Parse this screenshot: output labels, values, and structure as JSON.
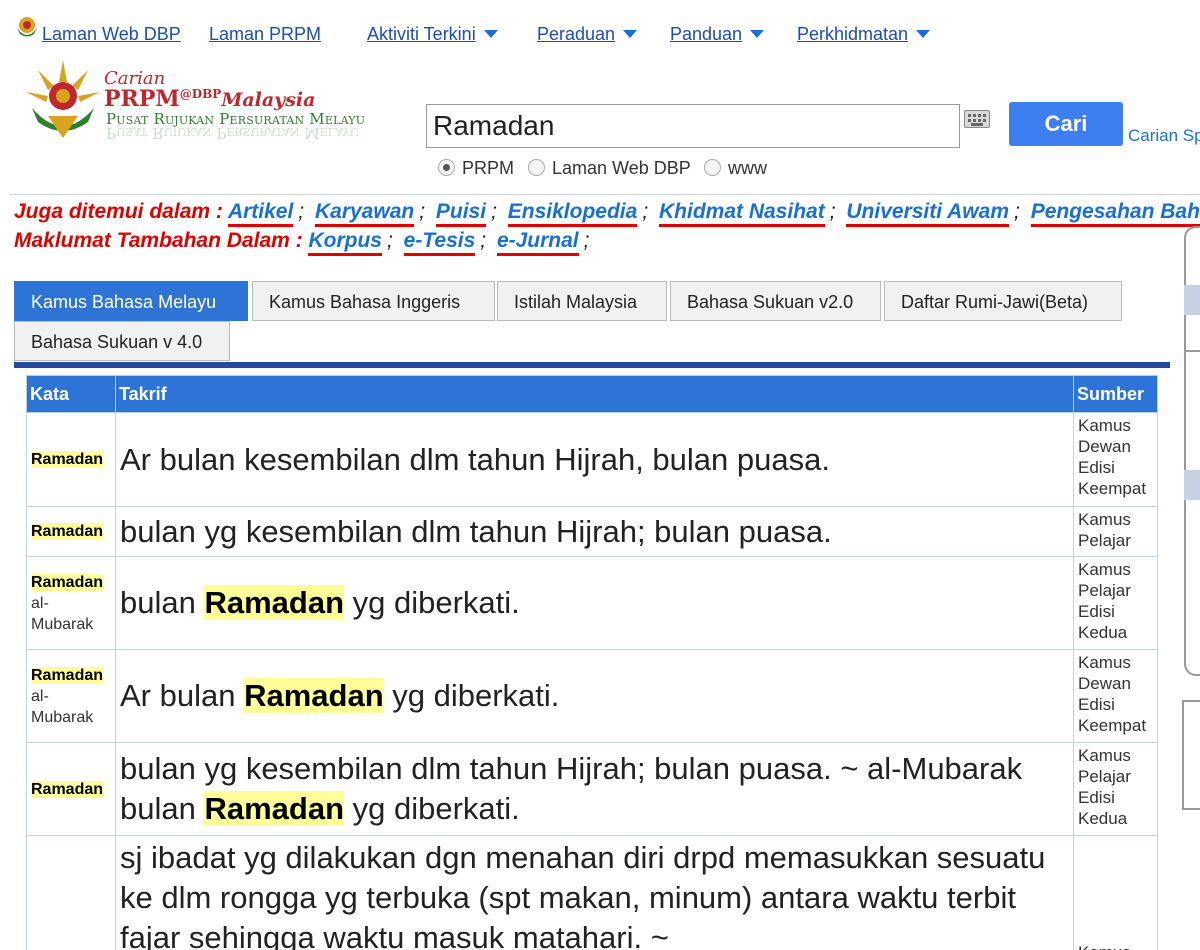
{
  "nav": {
    "items": [
      {
        "label": "Laman Web DBP",
        "dropdown": false
      },
      {
        "label": "Laman PRPM",
        "dropdown": false
      },
      {
        "label": "Aktiviti Terkini",
        "dropdown": true
      },
      {
        "label": "Peraduan",
        "dropdown": true
      },
      {
        "label": "Panduan",
        "dropdown": true
      },
      {
        "label": "Perkhidmatan",
        "dropdown": true
      }
    ]
  },
  "logo": {
    "carian": "Carian",
    "prpm": "PRPM",
    "dbp": "@DBP",
    "malaysia": "Malaysia",
    "pusat": "Pusat Rujukan Persuratan Melayu"
  },
  "search": {
    "value": "Ramadan",
    "button_label": "Cari",
    "carian_sp": "Carian Sp",
    "options": [
      {
        "label": "PRPM",
        "selected": true
      },
      {
        "label": "Laman Web DBP",
        "selected": false
      },
      {
        "label": "www",
        "selected": false
      }
    ]
  },
  "also_found": {
    "label": "Juga ditemui dalam :",
    "links": [
      "Artikel",
      "Karyawan",
      "Puisi",
      "Ensiklopedia",
      "Khidmat Nasihat",
      "Universiti Awam",
      "Pengesahan Bahasa"
    ]
  },
  "more_info": {
    "label": "Maklumat Tambahan Dalam :",
    "links": [
      "Korpus",
      "e-Tesis",
      "e-Jurnal"
    ]
  },
  "tabs": [
    {
      "label": "Kamus Bahasa Melayu",
      "active": true
    },
    {
      "label": "Kamus Bahasa Inggeris",
      "active": false
    },
    {
      "label": "Istilah Malaysia",
      "active": false
    },
    {
      "label": "Bahasa Sukuan v2.0",
      "active": false
    },
    {
      "label": "Daftar Rumi-Jawi(Beta)",
      "active": false
    },
    {
      "label": "Bahasa Sukuan v 4.0",
      "active": false
    }
  ],
  "table": {
    "headers": {
      "kata": "Kata",
      "takrif": "Takrif",
      "sumber": "Sumber"
    },
    "rows": [
      {
        "kata_hl": "Ramadan",
        "kata_rest": "",
        "takrif": [
          [
            "t",
            "Ar bulan kesembilan dlm tahun Hijrah, bulan puasa."
          ]
        ],
        "sumber": "Kamus Dewan Edisi Keempat"
      },
      {
        "kata_hl": "Ramadan",
        "kata_rest": "",
        "takrif": [
          [
            "t",
            "bulan yg kesembilan dlm tahun Hijrah; bulan puasa."
          ]
        ],
        "sumber": "Kamus Pelajar"
      },
      {
        "kata_hl": "Ramadan",
        "kata_rest": "al-Mubarak",
        "takrif": [
          [
            "t",
            "bulan "
          ],
          [
            "h",
            "Ramadan"
          ],
          [
            "t",
            " yg diberkati."
          ]
        ],
        "sumber": "Kamus Pelajar Edisi Kedua"
      },
      {
        "kata_hl": "Ramadan",
        "kata_rest": "al-Mubarak",
        "takrif": [
          [
            "t",
            "Ar bulan "
          ],
          [
            "h",
            "Ramadan"
          ],
          [
            "t",
            " yg diberkati."
          ]
        ],
        "sumber": "Kamus Dewan Edisi Keempat"
      },
      {
        "kata_hl": "Ramadan",
        "kata_rest": "",
        "takrif": [
          [
            "t",
            "bulan yg kesembilan dlm tahun Hijrah; bulan puasa. ~ al-Mubarak bulan "
          ],
          [
            "h",
            "Ramadan"
          ],
          [
            "t",
            " yg diberkati."
          ]
        ],
        "sumber": "Kamus Pelajar Edisi Kedua"
      },
      {
        "kata_hl": "",
        "kata_rest": "",
        "takrif": [
          [
            "t",
            "sj ibadat yg dilakukan dgn menahan diri drpd memasukkan sesuatu ke dlm rongga yg terbuka (spt makan, minum) antara waktu terbit fajar sehingga waktu masuk matahari. ~"
          ]
        ],
        "sumber": "Kamus"
      }
    ]
  }
}
